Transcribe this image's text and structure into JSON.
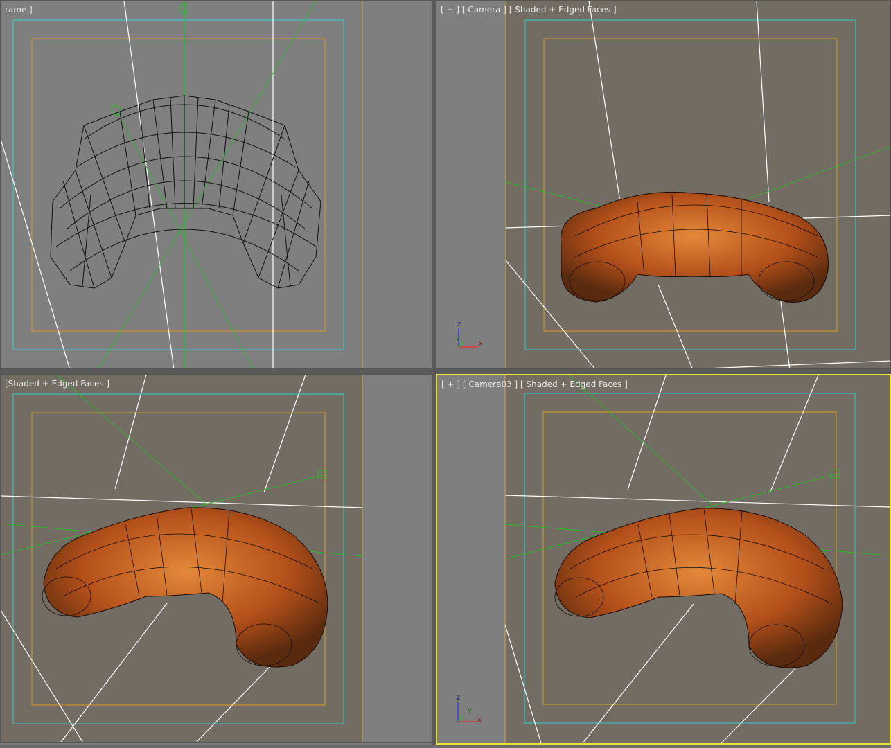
{
  "viewports": {
    "top_left": {
      "label": "rame ]"
    },
    "top_right": {
      "label": "[ + ] [ Camera ] [ Shaded + Edged Faces ]"
    },
    "bottom_left": {
      "label": "[Shaded + Edged Faces ]"
    },
    "bottom_right": {
      "label": "[ + ] [ Camera03 ] [ Shaded + Edged Faces ]"
    }
  },
  "axis_labels": {
    "z": "z",
    "y": "y",
    "x": "x"
  },
  "colors": {
    "viewport_bg": "#7f7f7f",
    "safe_frame_bg": "#736c62",
    "safe_frame_outer": "#2fd0d0",
    "safe_frame_inner": "#d79a1e",
    "active_border": "#e8e23a",
    "croissant": "#c05a1e",
    "helper_line": "#2fb52f",
    "horizon": "#ffffff"
  }
}
